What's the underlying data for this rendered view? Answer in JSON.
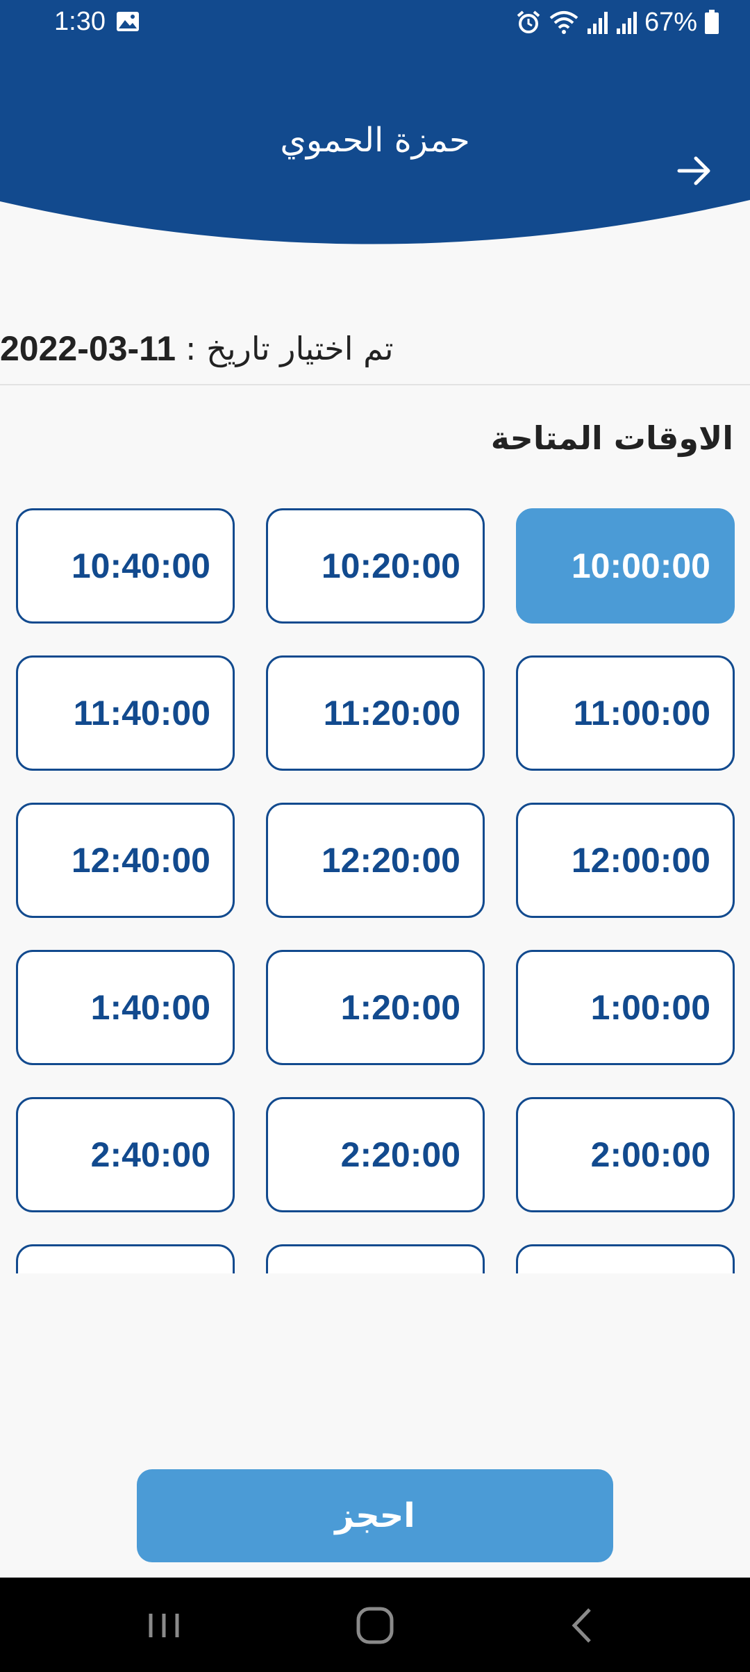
{
  "status_bar": {
    "time": "1:30",
    "battery": "67%",
    "icons": [
      "gallery-icon",
      "alarm-icon",
      "wifi-icon",
      "signal-icon",
      "signal-icon",
      "battery-icon"
    ]
  },
  "header": {
    "title": "حمزة الحموي",
    "back_icon": "arrow-right-icon"
  },
  "date": {
    "label": "تم اختيار تاريخ :",
    "value": "2022-03-11"
  },
  "section_title": "الاوقات المتاحة",
  "slots": [
    {
      "label": "10:00:00",
      "selected": true
    },
    {
      "label": "10:20:00",
      "selected": false
    },
    {
      "label": "10:40:00",
      "selected": false
    },
    {
      "label": "11:00:00",
      "selected": false
    },
    {
      "label": "11:20:00",
      "selected": false
    },
    {
      "label": "11:40:00",
      "selected": false
    },
    {
      "label": "12:00:00",
      "selected": false
    },
    {
      "label": "12:20:00",
      "selected": false
    },
    {
      "label": "12:40:00",
      "selected": false
    },
    {
      "label": "1:00:00",
      "selected": false
    },
    {
      "label": "1:20:00",
      "selected": false
    },
    {
      "label": "1:40:00",
      "selected": false
    },
    {
      "label": "2:00:00",
      "selected": false
    },
    {
      "label": "2:20:00",
      "selected": false
    },
    {
      "label": "2:40:00",
      "selected": false
    },
    {
      "label": "",
      "selected": false
    },
    {
      "label": "",
      "selected": false
    },
    {
      "label": "",
      "selected": false
    }
  ],
  "book_button": {
    "label": "احجز"
  },
  "nav_bar": {
    "icons": [
      "recent-apps-icon",
      "home-icon",
      "back-icon"
    ]
  },
  "colors": {
    "primary": "#124a8e",
    "accent": "#4b9bd6",
    "background": "#f8f8f8"
  }
}
